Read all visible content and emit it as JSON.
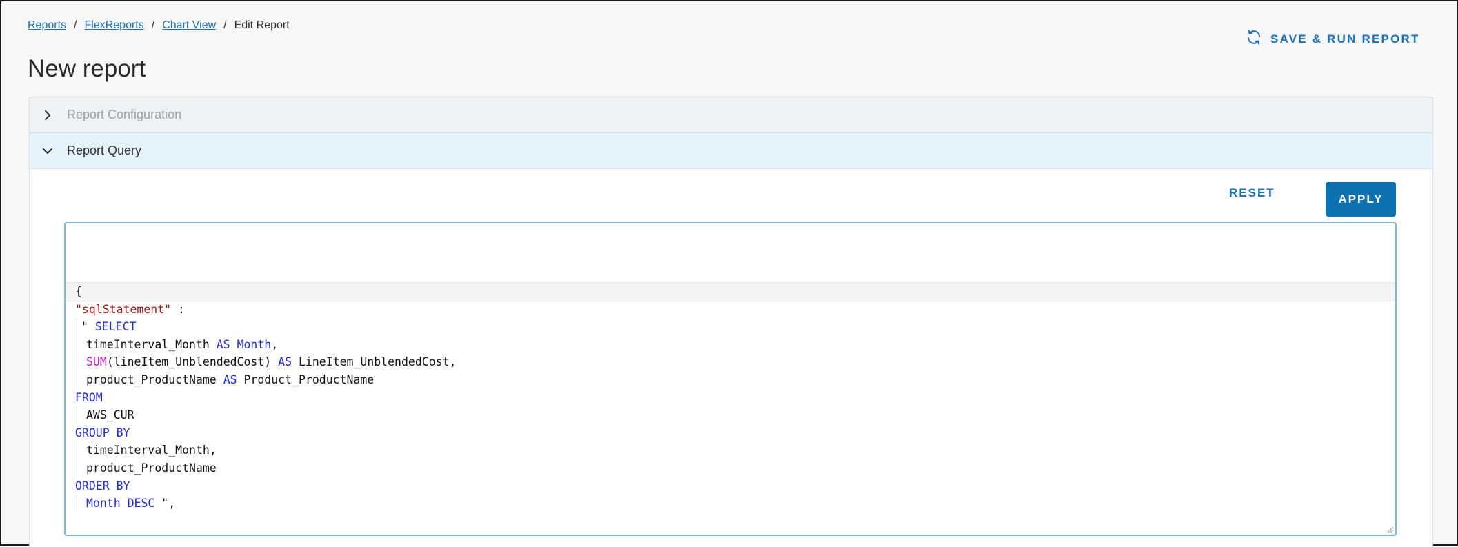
{
  "breadcrumb": {
    "items": [
      "Reports",
      "FlexReports",
      "Chart View"
    ],
    "current": "Edit Report",
    "separator": "/"
  },
  "page": {
    "title": "New report"
  },
  "header_action": {
    "save_run_label": "SAVE & RUN REPORT",
    "icon": "refresh-icon"
  },
  "accordion": {
    "config": {
      "label": "Report Configuration",
      "state": "collapsed"
    },
    "query": {
      "label": "Report Query",
      "state": "expanded"
    }
  },
  "actions": {
    "reset_label": "RESET",
    "apply_label": "APPLY"
  },
  "editor": {
    "lines": [
      {
        "indent": 0,
        "bars": 0,
        "tokens": [
          {
            "t": "{",
            "c": ""
          }
        ]
      },
      {
        "indent": 0,
        "bars": 0,
        "tokens": [
          {
            "t": "\"sqlStatement\"",
            "c": "s"
          },
          {
            "t": " :",
            "c": ""
          }
        ]
      },
      {
        "indent": 1,
        "bars": 1,
        "tokens": [
          {
            "t": "\" ",
            "c": ""
          },
          {
            "t": "SELECT",
            "c": "k"
          }
        ]
      },
      {
        "indent": 2,
        "bars": 1,
        "tokens": [
          {
            "t": "timeInterval_Month ",
            "c": ""
          },
          {
            "t": "AS",
            "c": "k"
          },
          {
            "t": " ",
            "c": ""
          },
          {
            "t": "Month",
            "c": "k"
          },
          {
            "t": ",",
            "c": ""
          }
        ]
      },
      {
        "indent": 2,
        "bars": 1,
        "tokens": [
          {
            "t": "SUM",
            "c": "f"
          },
          {
            "t": "(lineItem_UnblendedCost) ",
            "c": ""
          },
          {
            "t": "AS",
            "c": "k"
          },
          {
            "t": " LineItem_UnblendedCost,",
            "c": ""
          }
        ]
      },
      {
        "indent": 2,
        "bars": 1,
        "tokens": [
          {
            "t": "product_ProductName ",
            "c": ""
          },
          {
            "t": "AS",
            "c": "k"
          },
          {
            "t": " Product_ProductName",
            "c": ""
          }
        ]
      },
      {
        "indent": 0,
        "bars": 0,
        "tokens": [
          {
            "t": "FROM",
            "c": "k"
          }
        ]
      },
      {
        "indent": 2,
        "bars": 1,
        "tokens": [
          {
            "t": "AWS_CUR",
            "c": ""
          }
        ]
      },
      {
        "indent": 0,
        "bars": 0,
        "tokens": [
          {
            "t": "GROUP BY",
            "c": "k"
          }
        ]
      },
      {
        "indent": 2,
        "bars": 1,
        "tokens": [
          {
            "t": "timeInterval_Month,",
            "c": ""
          }
        ]
      },
      {
        "indent": 2,
        "bars": 1,
        "tokens": [
          {
            "t": "product_ProductName",
            "c": ""
          }
        ]
      },
      {
        "indent": 0,
        "bars": 0,
        "tokens": [
          {
            "t": "ORDER BY",
            "c": "k"
          }
        ]
      },
      {
        "indent": 2,
        "bars": 1,
        "tokens": [
          {
            "t": "Month",
            "c": "k"
          },
          {
            "t": " ",
            "c": ""
          },
          {
            "t": "DESC",
            "c": "k"
          },
          {
            "t": " \",",
            "c": ""
          }
        ]
      }
    ]
  },
  "colors": {
    "link": "#1a73b8",
    "primary_button": "#0f72b0",
    "keyword": "#1f2bd6",
    "string": "#a31515",
    "function": "#c418c4",
    "expanded_header_bg": "#e4f3fb"
  }
}
